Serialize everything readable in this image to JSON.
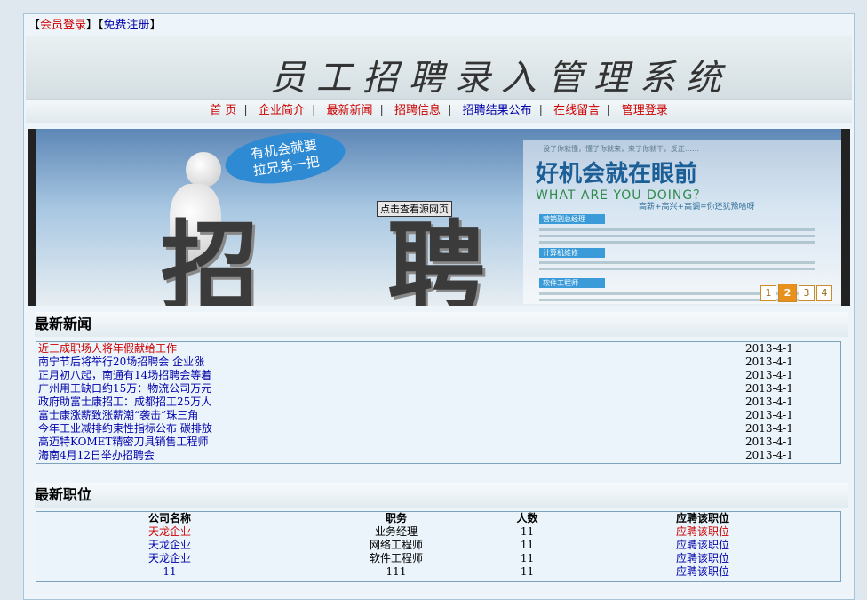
{
  "topbar": {
    "open": "【",
    "login": "会员登录",
    "mid": "】【",
    "register": "免费注册",
    "close": "】"
  },
  "site_title": "员工招聘录入管理系统",
  "nav": [
    "首 页",
    "企业简介",
    "最新新闻",
    "招聘信息",
    "招聘结果公布",
    "在线留言",
    "管理登录"
  ],
  "banner": {
    "bubble_line1": "有机会就要",
    "bubble_line2": "拉兄弟一把",
    "big_char_1": "招",
    "big_char_2": "聘",
    "source_link": "点击查看源网页",
    "panel_top": "设了你就懂，懂了你就来，来了你就干，反正……",
    "slogan": "好机会就在眼前",
    "slogan_en": "WHAT ARE YOU DOING？",
    "slogan_sub": "高薪+高兴+高调=你还犹豫啥呀",
    "job_tags": [
      "营销副总经理",
      "计算机维修",
      "软件工程师"
    ],
    "pages": [
      "1",
      "2",
      "3",
      "4"
    ],
    "active_page": 2
  },
  "news": {
    "title": "最新新闻",
    "items": [
      {
        "title": "近三成职场人将年假献给工作",
        "date": "2013-4-1"
      },
      {
        "title": "南宁节后将举行20场招聘会 企业涨",
        "date": "2013-4-1"
      },
      {
        "title": "正月初八起，南通有14场招聘会等着",
        "date": "2013-4-1"
      },
      {
        "title": "广州用工缺口约15万：物流公司万元",
        "date": "2013-4-1"
      },
      {
        "title": "政府助富士康招工：成都招工25万人",
        "date": "2013-4-1"
      },
      {
        "title": "富士康涨薪致涨薪潮“袭击”珠三角",
        "date": "2013-4-1"
      },
      {
        "title": "今年工业减排约束性指标公布 碳排放",
        "date": "2013-4-1"
      },
      {
        "title": "高迈特KOMET精密刀具销售工程师",
        "date": "2013-4-1"
      },
      {
        "title": "海南4月12日举办招聘会",
        "date": "2013-4-1"
      }
    ]
  },
  "jobs": {
    "title": "最新职位",
    "headers": [
      "公司名称",
      "职务",
      "人数",
      "应聘该职位"
    ],
    "rows": [
      {
        "company": "天龙企业",
        "position": "业务经理",
        "count": "11",
        "apply": "应聘该职位"
      },
      {
        "company": "天龙企业",
        "position": "网络工程师",
        "count": "11",
        "apply": "应聘该职位"
      },
      {
        "company": "天龙企业",
        "position": "软件工程师",
        "count": "11",
        "apply": "应聘该职位"
      },
      {
        "company": "11",
        "position": "111",
        "count": "11",
        "apply": "应聘该职位"
      }
    ]
  }
}
